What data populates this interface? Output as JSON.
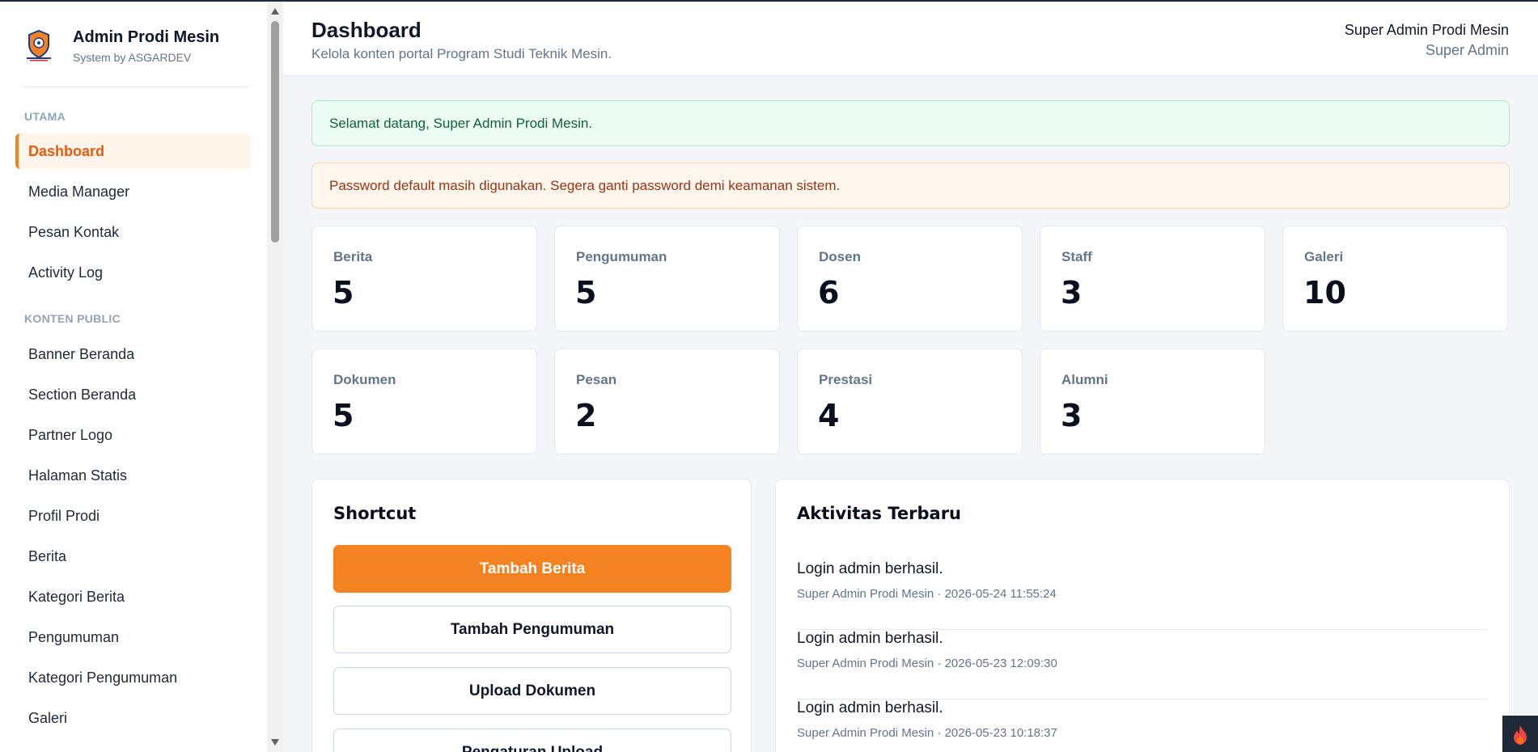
{
  "brand": {
    "title": "Admin Prodi Mesin",
    "subtitle": "System by ASGARDEV",
    "logo_icon": "university-logo-icon"
  },
  "sidebar": {
    "sections": [
      {
        "title": "UTAMA",
        "items": [
          {
            "label": "Dashboard",
            "active": true
          },
          {
            "label": "Media Manager"
          },
          {
            "label": "Pesan Kontak"
          },
          {
            "label": "Activity Log"
          }
        ]
      },
      {
        "title": "KONTEN PUBLIC",
        "items": [
          {
            "label": "Banner Beranda"
          },
          {
            "label": "Section Beranda"
          },
          {
            "label": "Partner Logo"
          },
          {
            "label": "Halaman Statis"
          },
          {
            "label": "Profil Prodi"
          },
          {
            "label": "Berita"
          },
          {
            "label": "Kategori Berita"
          },
          {
            "label": "Pengumuman"
          },
          {
            "label": "Kategori Pengumuman"
          },
          {
            "label": "Galeri"
          }
        ]
      }
    ]
  },
  "header": {
    "title": "Dashboard",
    "subtitle": "Kelola konten portal Program Studi Teknik Mesin.",
    "user_name": "Super Admin Prodi Mesin",
    "user_role": "Super Admin"
  },
  "alerts": {
    "success": "Selamat datang, Super Admin Prodi Mesin.",
    "warning": "Password default masih digunakan. Segera ganti password demi keamanan sistem."
  },
  "stats": [
    {
      "label": "Berita",
      "value": "5"
    },
    {
      "label": "Pengumuman",
      "value": "5"
    },
    {
      "label": "Dosen",
      "value": "6"
    },
    {
      "label": "Staff",
      "value": "3"
    },
    {
      "label": "Galeri",
      "value": "10"
    },
    {
      "label": "Dokumen",
      "value": "5"
    },
    {
      "label": "Pesan",
      "value": "2"
    },
    {
      "label": "Prestasi",
      "value": "4"
    },
    {
      "label": "Alumni",
      "value": "3"
    }
  ],
  "shortcut": {
    "title": "Shortcut",
    "buttons": [
      "Tambah Berita",
      "Tambah Pengumuman",
      "Upload Dokumen",
      "Pengaturan Upload"
    ]
  },
  "activity": {
    "title": "Aktivitas Terbaru",
    "items": [
      {
        "title": "Login admin berhasil.",
        "meta": "Super Admin Prodi Mesin · 2026-05-24 11:55:24"
      },
      {
        "title": "Login admin berhasil.",
        "meta": "Super Admin Prodi Mesin · 2026-05-23 12:09:30"
      },
      {
        "title": "Login admin berhasil.",
        "meta": "Super Admin Prodi Mesin · 2026-05-23 10:18:37"
      }
    ]
  },
  "colors": {
    "accent": "#f58220",
    "accent_text": "#ea5a0c",
    "success_bg": "#ecfdf3",
    "warning_bg": "#fff6ed"
  },
  "corner_icon": "flame-icon"
}
